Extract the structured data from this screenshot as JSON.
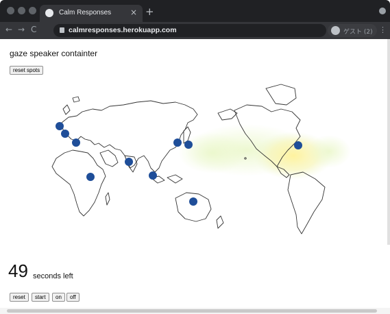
{
  "browser": {
    "tab_title": "Calm Responses",
    "tab_close": "×",
    "new_tab": "+",
    "url": "calmresponses.herokuapp.com",
    "profile_label": "ゲスト (2)",
    "nav": {
      "back": "←",
      "forward": "→",
      "reload": "C"
    },
    "menu": "⋮"
  },
  "page": {
    "title": "gaze speaker containter",
    "reset_spots_label": "reset spots",
    "timer_value": "49",
    "timer_label": "seconds left",
    "controls": [
      "reset",
      "start",
      "on",
      "off"
    ]
  },
  "map": {
    "marker_color": "#1f4e99",
    "heat_colors": [
      "#e9f5c8",
      "#fff3a6"
    ],
    "spots": [
      {
        "name": "ireland"
      },
      {
        "name": "uk"
      },
      {
        "name": "france"
      },
      {
        "name": "nigeria"
      },
      {
        "name": "india"
      },
      {
        "name": "singapore"
      },
      {
        "name": "korea"
      },
      {
        "name": "japan"
      },
      {
        "name": "australia"
      },
      {
        "name": "usa"
      }
    ]
  }
}
